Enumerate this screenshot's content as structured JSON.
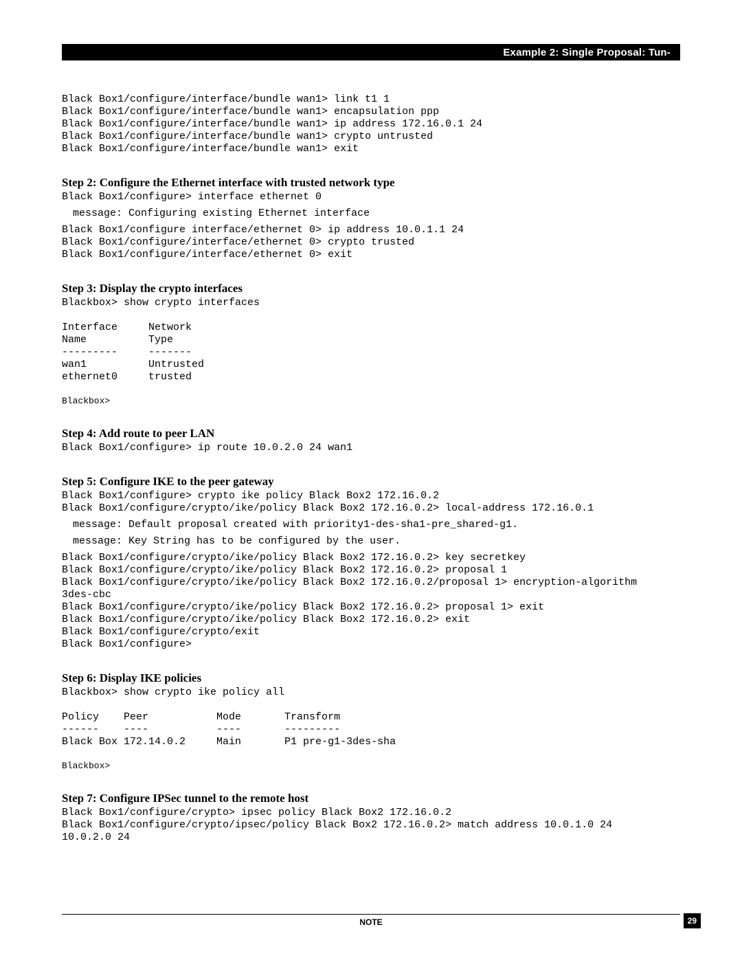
{
  "header": {
    "title": "Example 2: Single Proposal: Tun-"
  },
  "intro_cli": "Black Box1/configure/interface/bundle wan1> link t1 1\nBlack Box1/configure/interface/bundle wan1> encapsulation ppp\nBlack Box1/configure/interface/bundle wan1> ip address 172.16.0.1 24\nBlack Box1/configure/interface/bundle wan1> crypto untrusted\nBlack Box1/configure/interface/bundle wan1> exit",
  "step2": {
    "heading": "Step 2: Configure the Ethernet interface with trusted network type",
    "cli_a": "Black Box1/configure> interface ethernet 0",
    "msg": "message: Configuring existing Ethernet interface",
    "cli_b": "Black Box1/configure interface/ethernet 0> ip address 10.0.1.1 24\nBlack Box1/configure/interface/ethernet 0> crypto trusted\nBlack Box1/configure/interface/ethernet 0> exit"
  },
  "step3": {
    "heading": "Step 3: Display the crypto interfaces",
    "cli": "Blackbox> show crypto interfaces\n\nInterface     Network\nName          Type\n---------     -------\nwan1          Untrusted\nethernet0     trusted",
    "prompt": "Blackbox>"
  },
  "step4": {
    "heading": "Step 4: Add route to peer LAN",
    "cli": "Black Box1/configure> ip route 10.0.2.0 24 wan1"
  },
  "step5": {
    "heading": "Step 5: Configure IKE to the peer gateway",
    "cli_a": "Black Box1/configure> crypto ike policy Black Box2 172.16.0.2\nBlack Box1/configure/crypto/ike/policy Black Box2 172.16.0.2> local-address 172.16.0.1",
    "msg1": "message: Default proposal created with priority1-des-sha1-pre_shared-g1.",
    "msg2": "message: Key String has to be configured by the user.",
    "cli_b": "Black Box1/configure/crypto/ike/policy Black Box2 172.16.0.2> key secretkey\nBlack Box1/configure/crypto/ike/policy Black Box2 172.16.0.2> proposal 1\nBlack Box1/configure/crypto/ike/policy Black Box2 172.16.0.2/proposal 1> encryption-algorithm \n3des-cbc\nBlack Box1/configure/crypto/ike/policy Black Box2 172.16.0.2> proposal 1> exit\nBlack Box1/configure/crypto/ike/policy Black Box2 172.16.0.2> exit\nBlack Box1/configure/crypto/exit\nBlack Box1/configure>"
  },
  "step6": {
    "heading": "Step 6: Display IKE policies",
    "cli": "Blackbox> show crypto ike policy all\n\nPolicy    Peer           Mode       Transform\n------    ----           ----       ---------\nBlack Box 172.14.0.2     Main       P1 pre-g1-3des-sha",
    "prompt": "Blackbox>"
  },
  "step7": {
    "heading": "Step 7: Configure IPSec tunnel to the remote host",
    "cli": "Black Box1/configure/crypto> ipsec policy Black Box2 172.16.0.2\nBlack Box1/configure/crypto/ipsec/policy Black Box2 172.16.0.2> match address 10.0.1.0 24 \n10.0.2.0 24"
  },
  "footer": {
    "note": "NOTE",
    "page_number": "29"
  }
}
